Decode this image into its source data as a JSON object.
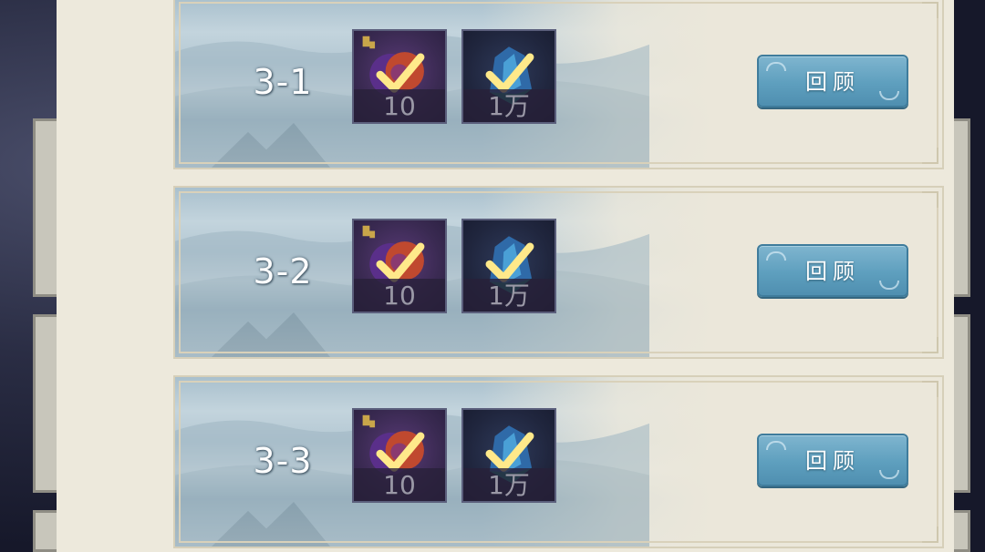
{
  "stages": [
    {
      "label": "3-1",
      "rewards": [
        {
          "icon": "fragment-orb-icon",
          "qty": "10",
          "claimed": true
        },
        {
          "icon": "blue-crystal-icon",
          "qty": "1万",
          "claimed": true
        }
      ],
      "review_label": "回顾"
    },
    {
      "label": "3-2",
      "rewards": [
        {
          "icon": "fragment-orb-icon",
          "qty": "10",
          "claimed": true
        },
        {
          "icon": "blue-crystal-icon",
          "qty": "1万",
          "claimed": true
        }
      ],
      "review_label": "回顾"
    },
    {
      "label": "3-3",
      "rewards": [
        {
          "icon": "fragment-orb-icon",
          "qty": "10",
          "claimed": true
        },
        {
          "icon": "blue-crystal-icon",
          "qty": "1万",
          "claimed": true
        }
      ],
      "review_label": "回顾"
    }
  ],
  "colors": {
    "panel": "#ede9dc",
    "button": "#5e9fbe",
    "checkmark": "#ffe98a"
  }
}
